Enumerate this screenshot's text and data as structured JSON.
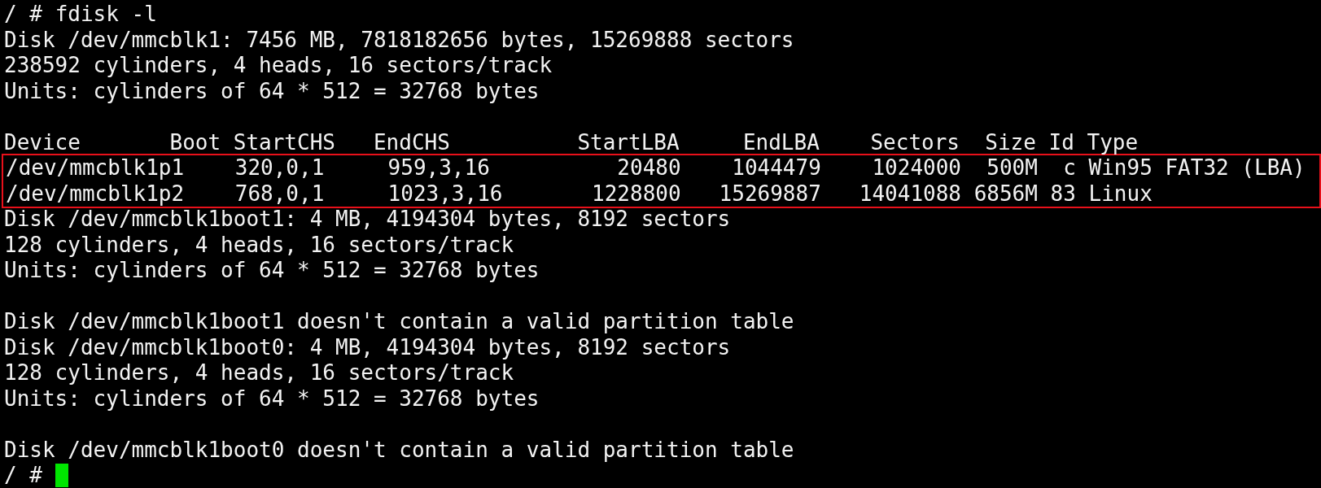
{
  "lines": [
    {
      "kind": "prompt",
      "prompt": "/ #",
      "command": "fdisk -l"
    },
    {
      "kind": "text",
      "text": "Disk /dev/mmcblk1: 7456 MB, 7818182656 bytes, 15269888 sectors"
    },
    {
      "kind": "text",
      "text": "238592 cylinders, 4 heads, 16 sectors/track"
    },
    {
      "kind": "text",
      "text": "Units: cylinders of 64 * 512 = 32768 bytes"
    },
    {
      "kind": "blank"
    },
    {
      "kind": "table",
      "highlighted": true,
      "header": "Device       Boot StartCHS   EndCHS          StartLBA     EndLBA    Sectors  Size Id Type",
      "rows": [
        "/dev/mmcblk1p1    320,0,1     959,3,16          20480    1044479    1024000  500M  c Win95 FAT32 (LBA)",
        "/dev/mmcblk1p2    768,0,1     1023,3,16       1228800   15269887   14041088 6856M 83 Linux"
      ]
    },
    {
      "kind": "text",
      "text": "Disk /dev/mmcblk1boot1: 4 MB, 4194304 bytes, 8192 sectors"
    },
    {
      "kind": "text",
      "text": "128 cylinders, 4 heads, 16 sectors/track"
    },
    {
      "kind": "text",
      "text": "Units: cylinders of 64 * 512 = 32768 bytes"
    },
    {
      "kind": "blank"
    },
    {
      "kind": "text",
      "text": "Disk /dev/mmcblk1boot1 doesn't contain a valid partition table"
    },
    {
      "kind": "text",
      "text": "Disk /dev/mmcblk1boot0: 4 MB, 4194304 bytes, 8192 sectors"
    },
    {
      "kind": "text",
      "text": "128 cylinders, 4 heads, 16 sectors/track"
    },
    {
      "kind": "text",
      "text": "Units: cylinders of 64 * 512 = 32768 bytes"
    },
    {
      "kind": "blank"
    },
    {
      "kind": "text",
      "text": "Disk /dev/mmcblk1boot0 doesn't contain a valid partition table"
    },
    {
      "kind": "prompt",
      "prompt": "/ #",
      "cursor": true
    }
  ]
}
